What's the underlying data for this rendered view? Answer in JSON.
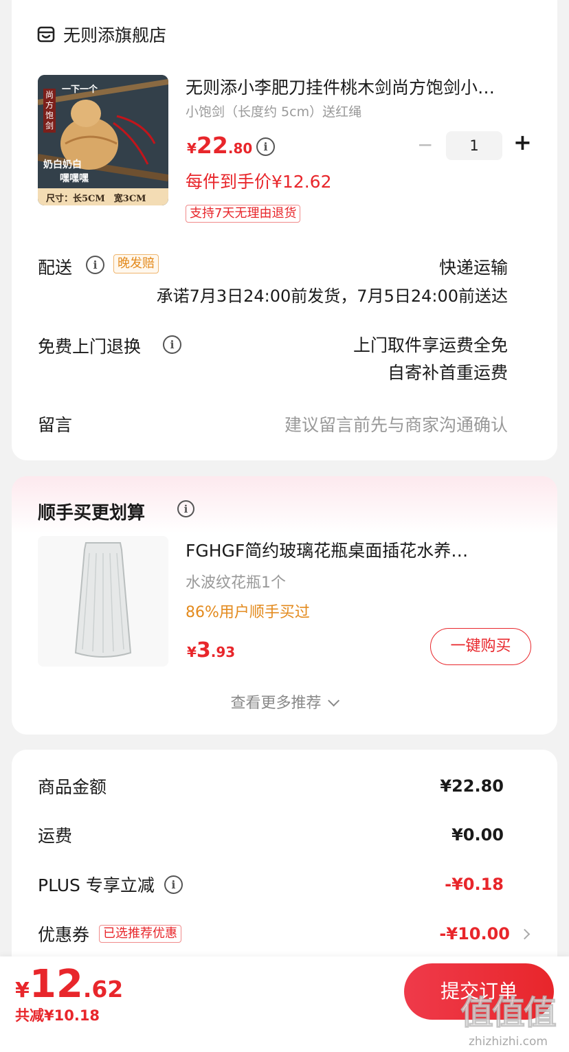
{
  "store": {
    "name": "无则添旗舰店"
  },
  "product": {
    "image_texts": {
      "top": "一下一个",
      "side": "尚方饱剑",
      "mid1": "奶白奶白",
      "mid2": "嘿嘿嘿",
      "size": "尺寸：长5CM　宽3CM"
    },
    "title": "无则添小李肥刀挂件桃木剑尚方饱剑小…",
    "spec": "小饱剑（长度约 5cm）送红绳",
    "price_symbol": "¥",
    "price_int": "22",
    "price_dec": ".80",
    "quantity": "1",
    "minus": "−",
    "plus": "+",
    "final_price": "每件到手价¥12.62",
    "return_tag": "支持7天无理由退货"
  },
  "delivery": {
    "label": "配送",
    "badge": "晚发赔",
    "method": "快递运输",
    "promise": "承诺7月3日24:00前发货，7月5日24:00前送达"
  },
  "return_service": {
    "label": "免费上门退换",
    "line1": "上门取件享运费全免",
    "line2": "自寄补首重运费"
  },
  "message": {
    "label": "留言",
    "placeholder": "建议留言前先与商家沟通确认"
  },
  "addon": {
    "title": "顺手买更划算",
    "product_title": "FGHGF简约玻璃花瓶桌面插花水养…",
    "spec": "水波纹花瓶1个",
    "hint": "86%用户顺手买过",
    "price_symbol": "¥",
    "price_int": "3",
    "price_dec": ".93",
    "buy_button": "一键购买",
    "more": "查看更多推荐"
  },
  "summary": {
    "rows": [
      {
        "label": "商品金额",
        "value": "¥22.80"
      },
      {
        "label": "运费",
        "value": "¥0.00"
      },
      {
        "label": "PLUS 专享立减",
        "value": "-¥0.18"
      },
      {
        "label": "优惠券",
        "badge": "已选推荐优惠",
        "value": "-¥10.00"
      }
    ]
  },
  "footer": {
    "price_symbol": "¥",
    "price_int": "12",
    "price_dec": ".62",
    "saved": "共减¥10.18",
    "submit": "提交订单"
  },
  "watermark": {
    "text": "值值值",
    "site": "zhizhizhi.com"
  },
  "colors": {
    "accent": "#e8262b",
    "orange": "#e38a1d",
    "bg": "#f2f2f2"
  }
}
